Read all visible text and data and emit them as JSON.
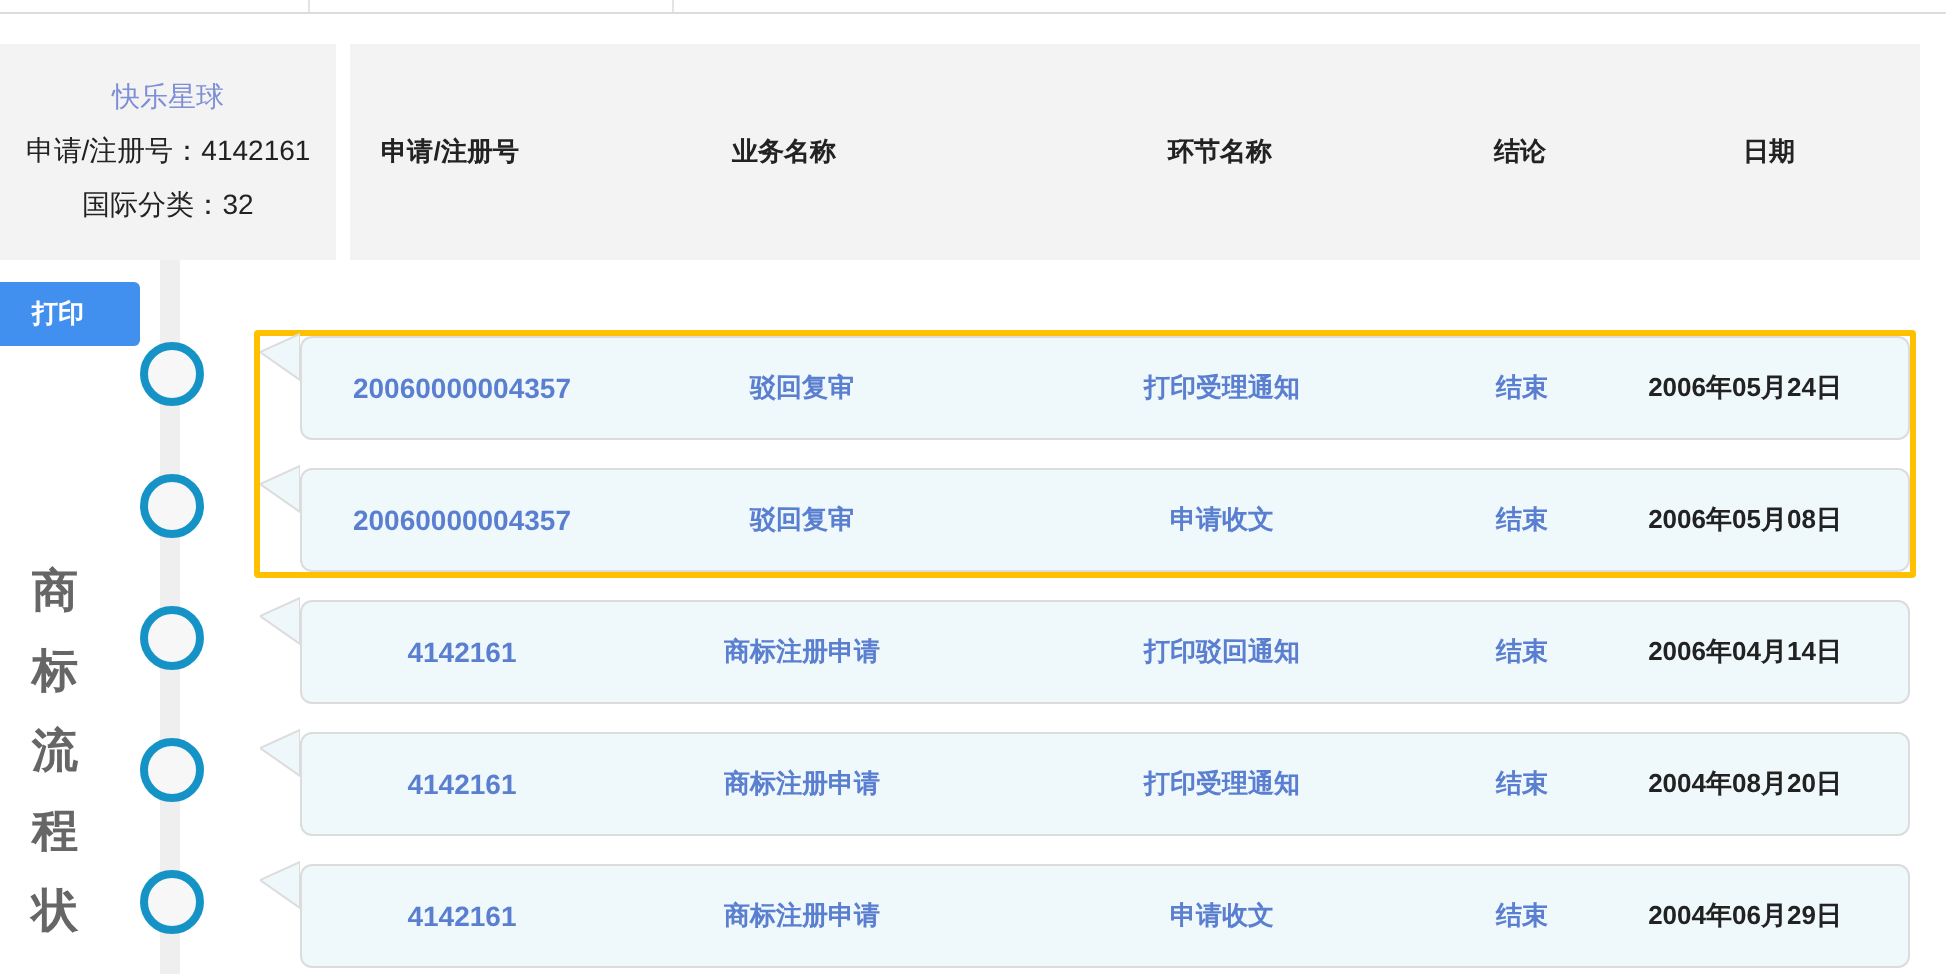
{
  "info": {
    "name": "快乐星球",
    "reg_label": "申请/注册号：4142161",
    "class_label": "国际分类：32"
  },
  "columns": [
    "申请/注册号",
    "业务名称",
    "环节名称",
    "结论",
    "日期"
  ],
  "print_button": "打印",
  "side_title": "商标流程状",
  "rows": [
    {
      "number": "20060000004357",
      "business": "驳回复审",
      "step": "打印受理通知",
      "result": "结束",
      "date": "2006年05月24日",
      "highlighted": true
    },
    {
      "number": "20060000004357",
      "business": "驳回复审",
      "step": "申请收文",
      "result": "结束",
      "date": "2006年05月08日",
      "highlighted": true
    },
    {
      "number": "4142161",
      "business": "商标注册申请",
      "step": "打印驳回通知",
      "result": "结束",
      "date": "2006年04月14日",
      "highlighted": false
    },
    {
      "number": "4142161",
      "business": "商标注册申请",
      "step": "打印受理通知",
      "result": "结束",
      "date": "2004年08月20日",
      "highlighted": false
    },
    {
      "number": "4142161",
      "business": "商标注册申请",
      "step": "申请收文",
      "result": "结束",
      "date": "2004年06月29日",
      "highlighted": false
    }
  ]
}
